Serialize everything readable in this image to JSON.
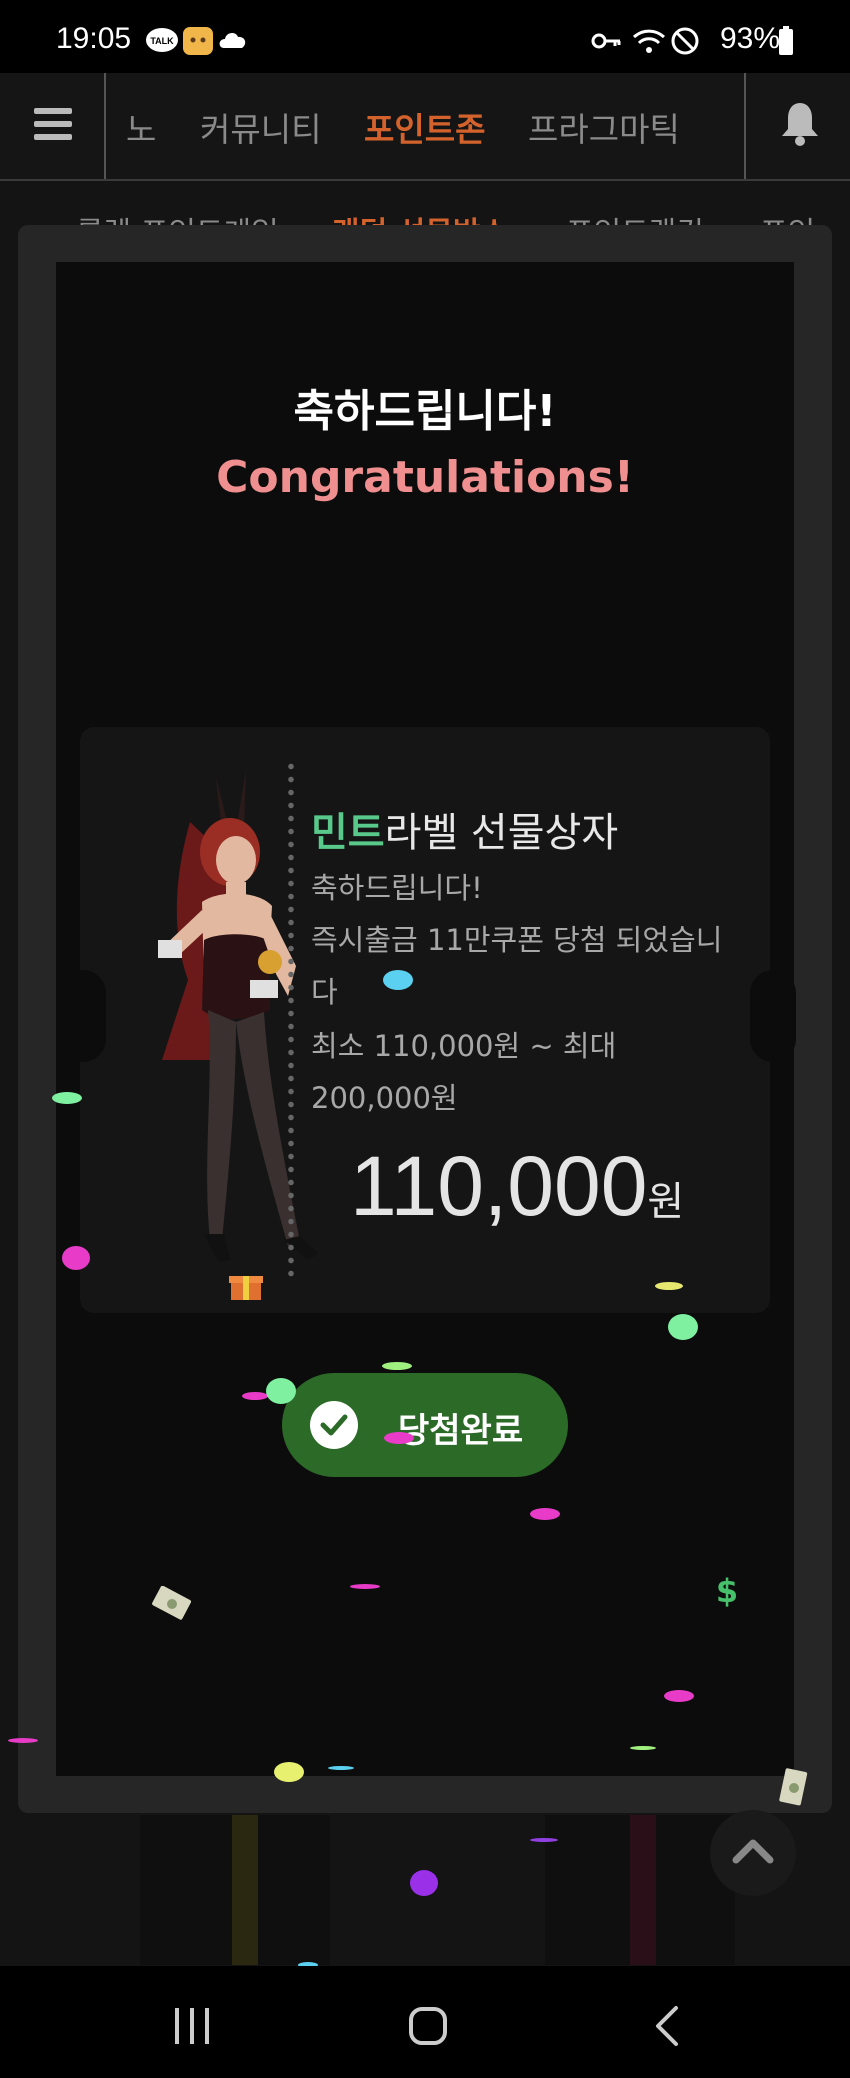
{
  "status_bar": {
    "time": "19:05",
    "battery": "93%"
  },
  "top_nav": {
    "items": [
      {
        "label": "노",
        "active": false
      },
      {
        "label": "커뮤니티",
        "active": false
      },
      {
        "label": "포인트존",
        "active": true
      },
      {
        "label": "프라그마틱",
        "active": false
      }
    ]
  },
  "sub_tabs": [
    {
      "label": "룰렛 포인트게임",
      "active": false
    },
    {
      "label": "랜덤 선물박스",
      "active": true
    },
    {
      "label": "포인트랭킹",
      "active": false
    },
    {
      "label": "포인",
      "active": false
    }
  ],
  "modal": {
    "title_ko": "축하드립니다!",
    "title_en": "Congratulations!",
    "prize": {
      "title_highlight": "민트",
      "title_rest": "라벨 선물상자",
      "line1": "축하드립니다!",
      "line2": "즉시출금 11만쿠폰 당첨 되었습니다",
      "line3": "최소 110,000원 ~ 최대 200,000원",
      "amount": "110,000",
      "unit": "원"
    },
    "button_label": "당첨완료"
  },
  "colors": {
    "accent_orange": "#d4622c",
    "mint": "#58c98b",
    "congrats_pink": "#f08f8f",
    "button_green": "#2c6a28"
  }
}
